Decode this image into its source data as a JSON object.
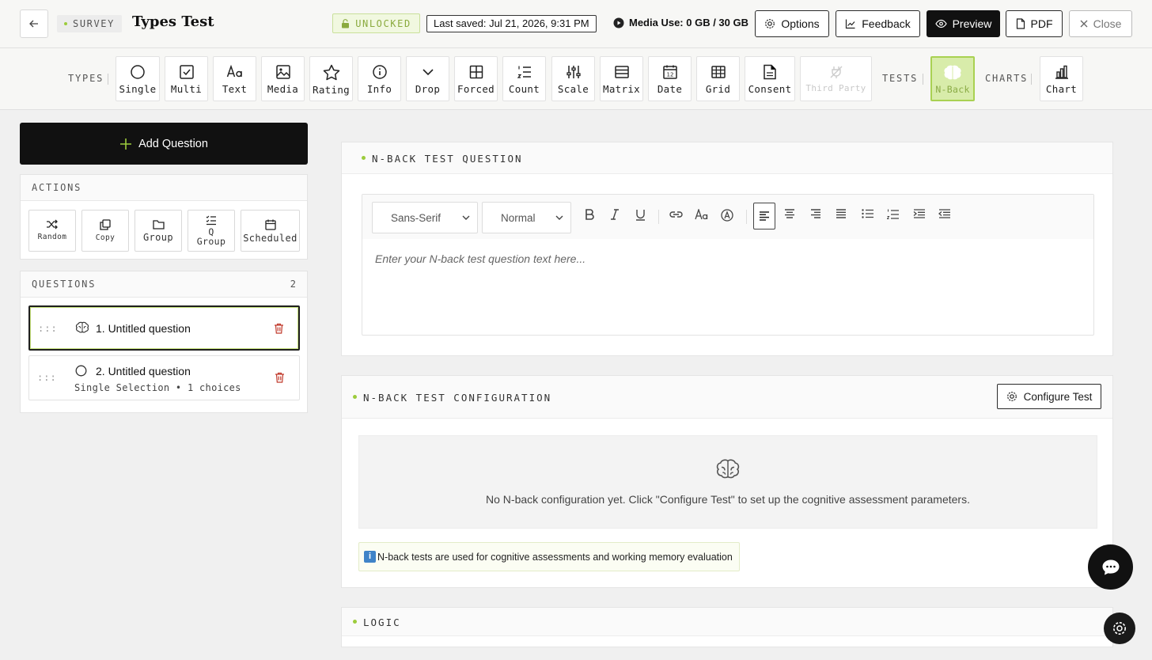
{
  "header": {
    "badge": "SURVEY",
    "title": "Types Test",
    "lock_status": "UNLOCKED",
    "last_saved": "Last saved: Jul 21, 2026, 9:31 PM",
    "media_use": "Media Use: 0 GB / 30 GB",
    "buttons": {
      "options": "Options",
      "feedback": "Feedback",
      "preview": "Preview",
      "pdf": "PDF",
      "close": "Close"
    }
  },
  "toolbar": {
    "types_label": "TYPES",
    "tests_label": "TESTS",
    "charts_label": "CHARTS",
    "tools": {
      "single": "Single",
      "multi": "Multi",
      "text": "Text",
      "media": "Media",
      "rating": "Rating",
      "info": "Info",
      "drop": "Drop",
      "forced": "Forced",
      "count": "Count",
      "scale": "Scale",
      "matrix": "Matrix",
      "date": "Date",
      "grid": "Grid",
      "consent": "Consent",
      "third_party": "Third Party",
      "nback": "N-Back",
      "chart": "Chart"
    }
  },
  "sidebar": {
    "add_question": "Add Question",
    "actions_title": "ACTIONS",
    "actions": {
      "random": "Random",
      "copy": "Copy",
      "group": "Group",
      "qgroup_1": "Q",
      "qgroup_2": "Group",
      "scheduled": "Scheduled"
    },
    "questions_title": "QUESTIONS",
    "questions_count": "2",
    "questions": [
      {
        "title": "1. Untitled question",
        "subtitle": ""
      },
      {
        "title": "2. Untitled question",
        "subtitle": "Single Selection • 1 choices"
      }
    ]
  },
  "question_card": {
    "title": "N-BACK TEST QUESTION",
    "font_select": "Sans-Serif",
    "size_select": "Normal",
    "placeholder": "Enter your N-back test question text here..."
  },
  "config_card": {
    "title": "N-BACK TEST CONFIGURATION",
    "button": "Configure Test",
    "empty_text": "No N-back configuration yet. Click \"Configure Test\" to set up the cognitive assessment parameters.",
    "info_icon": "i",
    "info_note": "N-back tests are used for cognitive assessments and working memory evaluation"
  },
  "logic_card": {
    "title": "LOGIC"
  },
  "colors": {
    "accent": "#9ccc3c",
    "active_tool_bg": "#d8ecaa",
    "dark": "#111111",
    "danger": "#c0392b"
  }
}
